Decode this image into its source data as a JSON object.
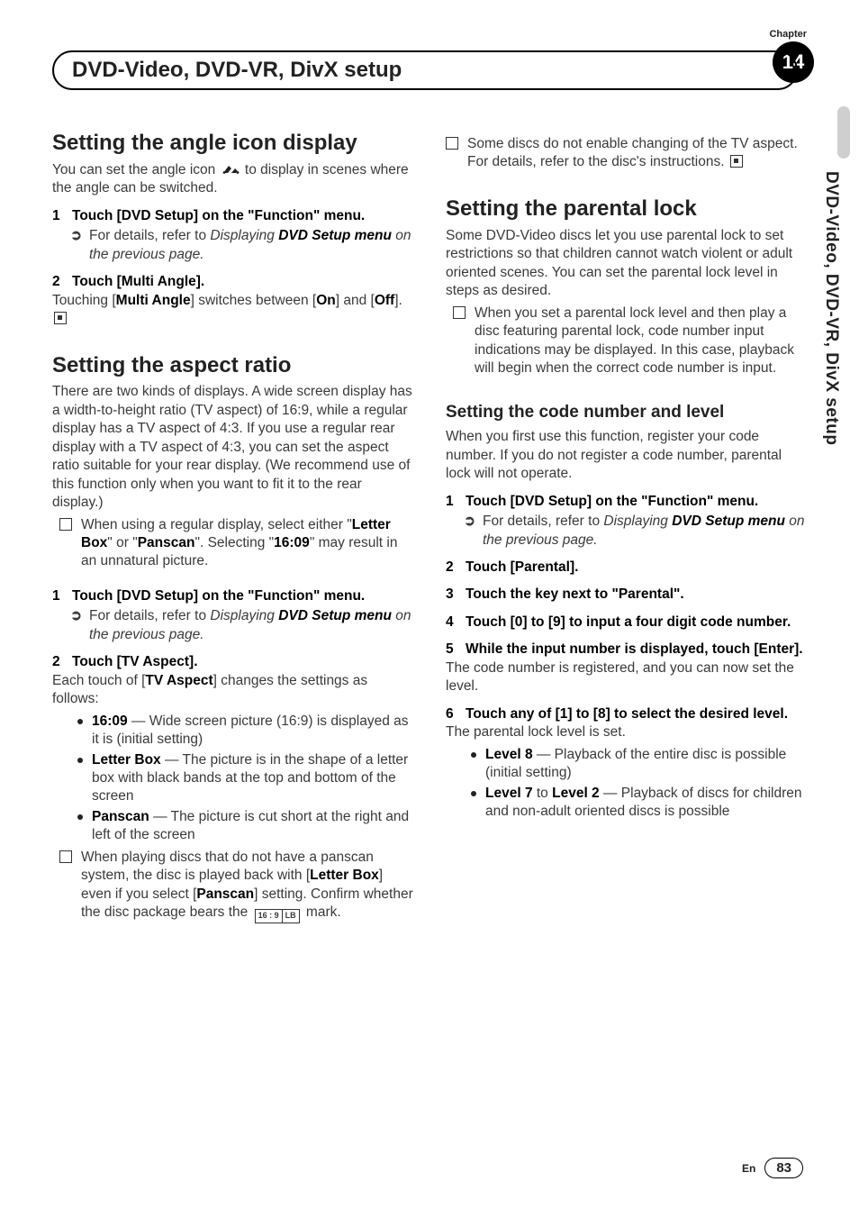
{
  "meta": {
    "chapter_label": "Chapter",
    "chapter_number": "14",
    "page_title": "DVD-Video, DVD-VR, DivX setup",
    "side_tab": "DVD-Video, DVD-VR, DivX setup",
    "footer_lang": "En",
    "footer_page": "83"
  },
  "left": {
    "s1": {
      "heading": "Setting the angle icon display",
      "intro_a": "You can set the angle icon ",
      "intro_b": " to display in scenes where the angle can be switched.",
      "step1_head": "Touch [DVD Setup] on the \"Function\" menu.",
      "ref_text_a": "For details, refer to ",
      "ref_link_em": "Displaying",
      "ref_link_strong": " DVD Setup menu",
      "ref_text_b": " on the previous page.",
      "step2_head": "Touch [Multi Angle].",
      "step2_body_a": "Touching [",
      "step2_body_multi": "Multi Angle",
      "step2_body_b": "] switches between [",
      "step2_on": "On",
      "step2_body_c": "] and [",
      "step2_off": "Off",
      "step2_body_d": "]."
    },
    "s2": {
      "heading": "Setting the aspect ratio",
      "intro": "There are two kinds of displays. A wide screen display has a width-to-height ratio (TV aspect) of 16:9, while a regular display has a TV aspect of 4:3. If you use a regular rear display with a TV aspect of 4:3, you can set the aspect ratio suitable for your rear display. (We recommend use of this function only when you want to fit it to the rear display.)",
      "note1_a": "When using a regular display, select either \"",
      "note1_lb": "Letter Box",
      "note1_b": "\" or \"",
      "note1_ps": "Panscan",
      "note1_c": "\". Selecting \"",
      "note1_169": "16:09",
      "note1_d": "\" may result in an unnatural picture.",
      "step1_head": "Touch [DVD Setup] on the \"Function\" menu.",
      "ref_text_a": "For details, refer to ",
      "ref_link_em": "Displaying",
      "ref_link_strong": " DVD Setup menu",
      "ref_text_b": " on the previous page.",
      "step2_head": "Touch [TV Aspect].",
      "step2_body_a": "Each touch of [",
      "step2_tva": "TV Aspect",
      "step2_body_b": "] changes the settings as follows:",
      "b1_label": "16:09",
      "b1_text": " — Wide screen picture (16:9) is displayed as it is (initial setting)",
      "b2_label": "Letter Box",
      "b2_text": " — The picture is in the shape of a letter box with black bands at the top and bottom of the screen",
      "b3_label": "Panscan",
      "b3_text": " — The picture is cut short at the right and left of the screen",
      "note2_a": "When playing discs that do not have a panscan system, the disc is played back with [",
      "note2_lb": "Letter Box",
      "note2_b": "] even if you select [",
      "note2_ps": "Panscan",
      "note2_c": "] setting. Confirm whether the disc package bears the ",
      "note2_mark_a": "16 : 9",
      "note2_mark_b": "LB",
      "note2_d": " mark."
    }
  },
  "right": {
    "carry_note": "Some discs do not enable changing of the TV aspect. For details, refer to the disc's instructions.",
    "s3": {
      "heading": "Setting the parental lock",
      "intro": "Some DVD-Video discs let you use parental lock to set restrictions so that children cannot watch violent or adult oriented scenes. You can set the parental lock level in steps as desired.",
      "note1": "When you set a parental lock level and then play a disc featuring parental lock, code number input indications may be displayed. In this case, playback will begin when the correct code number is input."
    },
    "s4": {
      "heading": "Setting the code number and level",
      "intro": "When you first use this function, register your code number. If you do not register a code number, parental lock will not operate.",
      "step1_head": "Touch [DVD Setup] on the \"Function\" menu.",
      "ref_text_a": "For details, refer to ",
      "ref_link_em": "Displaying",
      "ref_link_strong": " DVD Setup menu",
      "ref_text_b": " on the previous page.",
      "step2_head": "Touch [Parental].",
      "step3_head": "Touch the key next to \"Parental\".",
      "step4_head": "Touch [0] to [9] to input a four digit code number.",
      "step5_head": "While the input number is displayed, touch [Enter].",
      "step5_body": "The code number is registered, and you can now set the level.",
      "step6_head": "Touch any of [1] to [8] to select the desired level.",
      "step6_body": "The parental lock level is set.",
      "b1_label": "Level 8",
      "b1_text": " — Playback of the entire disc is possible (initial setting)",
      "b2_label": "Level 7",
      "b2_to": " to ",
      "b2_label2": "Level 2",
      "b2_text": " — Playback of discs for children and non-adult oriented discs is possible"
    }
  }
}
